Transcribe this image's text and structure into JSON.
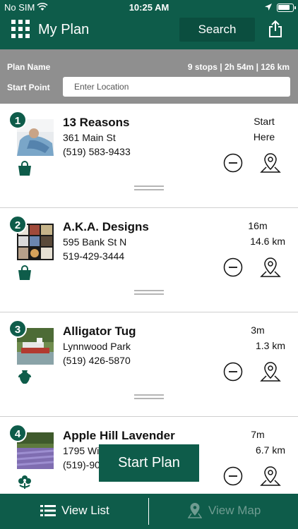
{
  "status_bar": {
    "carrier": "No SIM",
    "time": "10:25 AM"
  },
  "header": {
    "title": "My Plan",
    "search_label": "Search"
  },
  "plan": {
    "name_label": "Plan Name",
    "summary": "9 stops | 2h 54m | 126 km",
    "start_label": "Start Point",
    "start_placeholder": "Enter Location"
  },
  "stops": [
    {
      "number": "1",
      "name": "13 Reasons",
      "address": "361 Main St",
      "phone": "(519) 583-9433",
      "time": "Start",
      "distance": "Here",
      "category_icon": "shopping-bag-icon"
    },
    {
      "number": "2",
      "name": "A.K.A. Designs",
      "address": "595 Bank St N",
      "phone": "519-429-3444",
      "time": "16m",
      "distance": "14.6 km",
      "category_icon": "shopping-bag-icon"
    },
    {
      "number": "3",
      "name": "Alligator Tug",
      "address": "Lynnwood Park",
      "phone": "(519) 426-5870",
      "time": "3m",
      "distance": "1.3 km",
      "category_icon": "vase-icon"
    },
    {
      "number": "4",
      "name": "Apple Hill Lavender",
      "address": "1795 Wi",
      "phone": "(519)-90",
      "time": "7m",
      "distance": "6.7 km",
      "category_icon": "flower-icon"
    }
  ],
  "start_plan_label": "Start Plan",
  "bottom_bar": {
    "list_label": "View List",
    "map_label": "View Map"
  },
  "colors": {
    "primary": "#0e5c4a",
    "panel": "#8f8f8f",
    "disabled": "#6f9c91"
  }
}
